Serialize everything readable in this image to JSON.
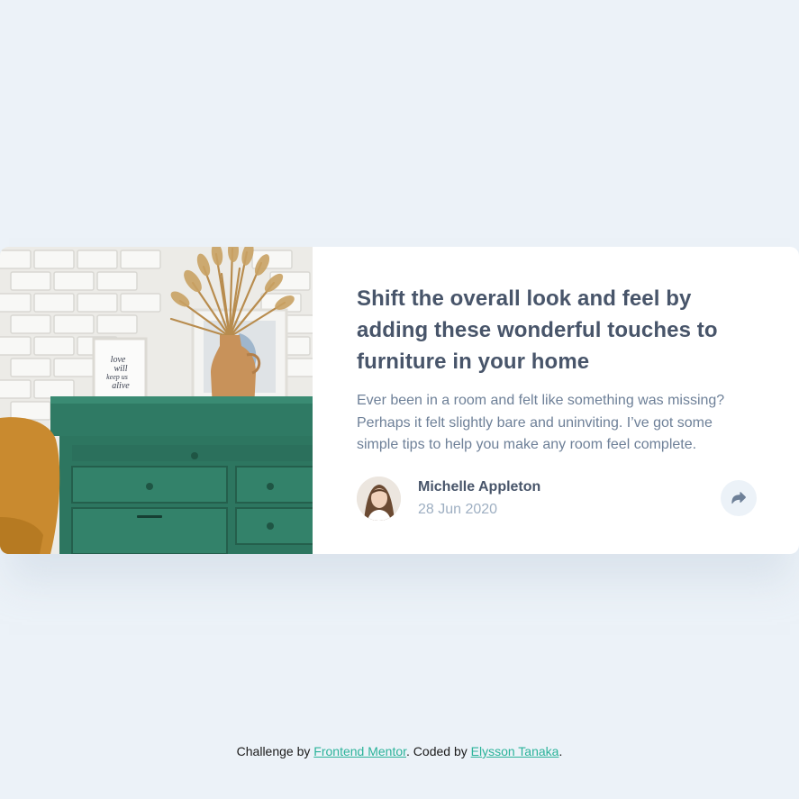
{
  "card": {
    "image": {
      "alt": "Green drawer with a vase of dried grass and framed prints",
      "frame_text": [
        "love",
        "will",
        "keep us",
        "alive"
      ]
    },
    "title": "Shift the overall look and feel by adding these wonderful touches to furniture in your home",
    "description": "Ever been in a room and felt like something was missing? Perhaps it felt slightly bare and uninviting. I’ve got some simple tips to help you make any room feel complete.",
    "author": {
      "name": "Michelle Appleton",
      "date": "28 Jun 2020",
      "avatar_icon": "avatar-michelle"
    },
    "share": {
      "icon": "share-icon",
      "label": "Share"
    }
  },
  "attribution": {
    "prefix": "Challenge by ",
    "challenge_link": "Frontend Mentor",
    "middle": ". Coded by ",
    "author_link": "Elysson Tanaka",
    "suffix": "."
  },
  "colors": {
    "background": "#ecf2f8",
    "title": "#48556a",
    "text": "#6e8098",
    "muted": "#9eafc2",
    "link": "#2bb39a",
    "drawer_green": "#2f7a64",
    "vase": "#c8925a"
  }
}
